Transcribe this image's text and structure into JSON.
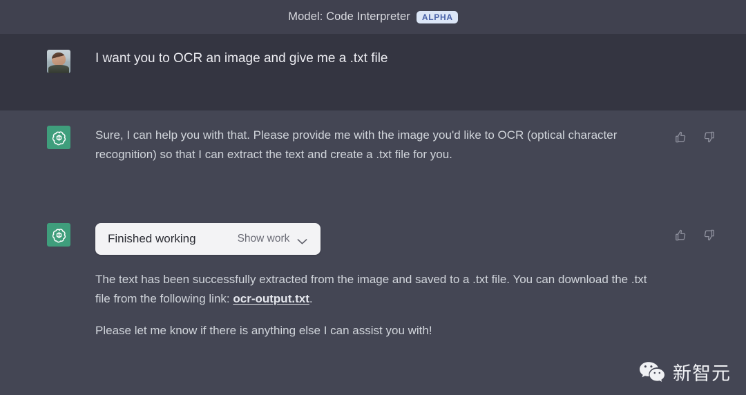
{
  "header": {
    "title": "Model: Code Interpreter",
    "badge": "ALPHA"
  },
  "conversation": [
    {
      "role": "user",
      "avatar_icon": "user-photo-avatar",
      "text": "I want you to OCR an image and give me a .txt file"
    },
    {
      "role": "assistant",
      "avatar_icon": "openai-logo-icon",
      "paragraphs": [
        "Sure, I can help you with that. Please provide me with the image you'd like to OCR (optical character recognition) so that I can extract the text and create a .txt file for you."
      ],
      "feedback": {
        "thumbs_up_icon": "thumbs-up-icon",
        "thumbs_down_icon": "thumbs-down-icon"
      }
    },
    {
      "role": "assistant",
      "avatar_icon": "openai-logo-icon",
      "work_panel": {
        "status": "Finished working",
        "toggle_label": "Show work",
        "chevron_icon": "chevron-down-icon"
      },
      "paragraphs": [
        {
          "before_link": "The text has been successfully extracted from the image and saved to a .txt file. You can download the .txt file from the following link: ",
          "link": "ocr-output.txt",
          "after_link": "."
        },
        "Please let me know if there is anything else I can assist you with!"
      ],
      "feedback": {
        "thumbs_up_icon": "thumbs-up-icon",
        "thumbs_down_icon": "thumbs-down-icon"
      }
    }
  ],
  "watermark": {
    "icon": "wechat-icon",
    "text": "新智元"
  },
  "colors": {
    "header_bg": "#40414f",
    "user_bg": "#343541",
    "assistant_bg": "#444654",
    "badge_bg": "#dce6f7",
    "badge_text": "#4a62a8",
    "avatar_green": "#3f9e7c",
    "panel_bg": "#f3f3f5",
    "body_text": "#d1d5db"
  }
}
